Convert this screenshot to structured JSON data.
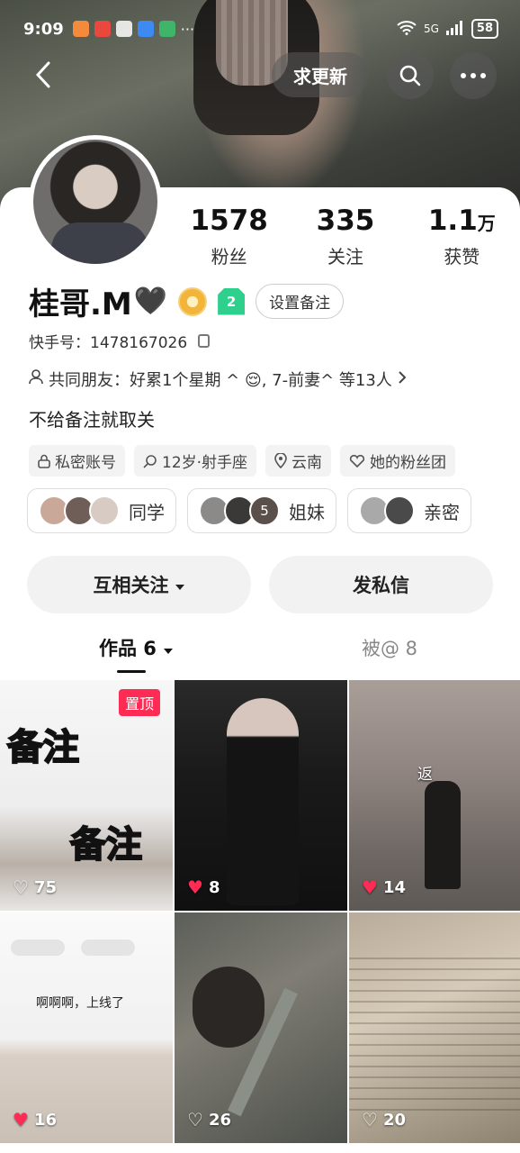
{
  "status_bar": {
    "time": "9:09",
    "network": "5G",
    "battery": "58"
  },
  "nav": {
    "update_label": "求更新"
  },
  "stats": [
    {
      "value": "1578",
      "unit": "",
      "label": "粉丝"
    },
    {
      "value": "335",
      "unit": "",
      "label": "关注"
    },
    {
      "value": "1.1",
      "unit": "万",
      "label": "获赞"
    }
  ],
  "profile": {
    "name": "桂哥.M",
    "level": "2",
    "remark_button": "设置备注",
    "kuaishou_id": "快手号：1478167026",
    "mutual_friends": "共同朋友：好累1个星期 ^ 😌, 7-前妻^ 等13人",
    "bio": "不给备注就取关",
    "tags": [
      "私密账号",
      "12岁·射手座",
      "云南",
      "她的粉丝团"
    ]
  },
  "groups": [
    {
      "label": "同学"
    },
    {
      "label": "姐妹",
      "count": "5"
    },
    {
      "label": "亲密"
    }
  ],
  "actions": {
    "follow": "互相关注",
    "message": "发私信"
  },
  "tabs": {
    "works": "作品 6",
    "mentioned": "被@ 8"
  },
  "videos": [
    {
      "likes": "75",
      "pinned": "置顶",
      "overlay": [
        "备注",
        "备注"
      ],
      "liked": false
    },
    {
      "likes": "8",
      "liked": true
    },
    {
      "likes": "14",
      "caption": "返",
      "liked": true
    },
    {
      "likes": "16",
      "caption": "啊啊啊，上线了",
      "liked": true
    },
    {
      "likes": "26",
      "liked": false
    },
    {
      "likes": "20",
      "liked": false
    }
  ],
  "colors": {
    "accent": "#fe2c55",
    "level_badge": "#2fcf8d"
  }
}
